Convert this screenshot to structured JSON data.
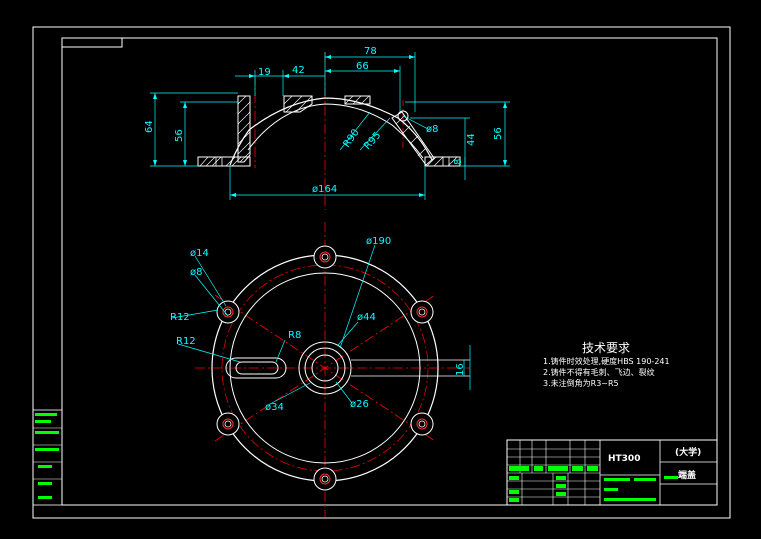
{
  "colors": {
    "background": "#000000",
    "outline": "#ffffff",
    "dimension": "#00ffff",
    "centerline": "#ff0000",
    "hatch": "#ffffff",
    "titleblock_fill": "#00ff00"
  },
  "section_view": {
    "dims": {
      "d78": "78",
      "d66": "66",
      "d19": "19",
      "d42": "42",
      "d64": "64",
      "d56_left": "56",
      "d56_right": "56",
      "d44": "44",
      "d8_right": "8",
      "d8_dia": "ø8",
      "r90": "R90",
      "r95": "R95",
      "d164": "ø164"
    }
  },
  "plan_view": {
    "dims": {
      "d190": "ø190",
      "d14": "ø14",
      "d8": "ø8",
      "r12_a": "R12",
      "r12_b": "R12",
      "r8": "R8",
      "d44": "ø44",
      "d34": "ø34",
      "d26": "ø26",
      "d16": "16"
    }
  },
  "notes": {
    "heading": "技术要求",
    "items": [
      "1.铸件时效处理,硬度HBS 190-241",
      "2.铸件不得有毛刺、飞边、裂纹",
      "3.未注倒角为R3~R5"
    ]
  },
  "title_block": {
    "material": "HT300",
    "school": "(大学)",
    "part_name": "端盖"
  }
}
